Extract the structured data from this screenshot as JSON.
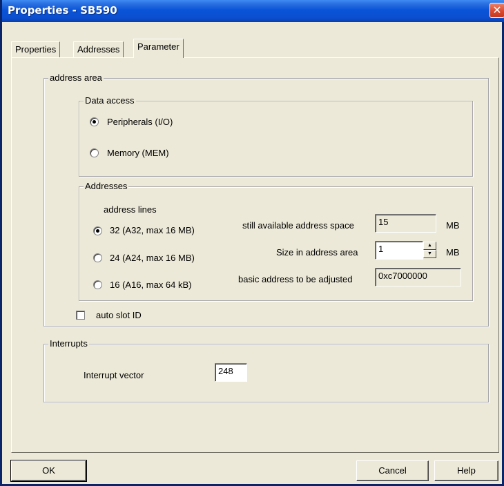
{
  "window": {
    "title": "Properties - SB590",
    "close_glyph": "✕"
  },
  "tabs": [
    {
      "label": "Properties",
      "active": false
    },
    {
      "label": "Addresses",
      "active": false
    },
    {
      "label": "Parameter",
      "active": true
    }
  ],
  "address_area": {
    "legend": "address area",
    "data_access": {
      "legend": "Data access",
      "options": [
        {
          "label": "Peripherals (I/O)",
          "selected": true
        },
        {
          "label": "Memory (MEM)",
          "selected": false
        }
      ]
    },
    "addresses": {
      "legend": "Addresses",
      "address_lines_label": "address lines",
      "options": [
        {
          "label": "32 (A32, max 16 MB)",
          "selected": true
        },
        {
          "label": "24 (A24, max 16 MB)",
          "selected": false
        },
        {
          "label": "16 (A16, max 64 kB)",
          "selected": false
        }
      ],
      "available_space": {
        "label": "still available address space",
        "value": "15",
        "unit": "MB"
      },
      "size": {
        "label": "Size in address area",
        "value": "1",
        "unit": "MB"
      },
      "basic_address": {
        "label": "basic address to be adjusted",
        "value": "0xc7000000"
      }
    },
    "auto_slot_id": {
      "label": "auto slot ID",
      "checked": false
    }
  },
  "interrupts": {
    "legend": "Interrupts",
    "vector_label": "Interrupt vector",
    "vector_value": "248"
  },
  "buttons": {
    "ok": "OK",
    "cancel": "Cancel",
    "help": "Help"
  }
}
